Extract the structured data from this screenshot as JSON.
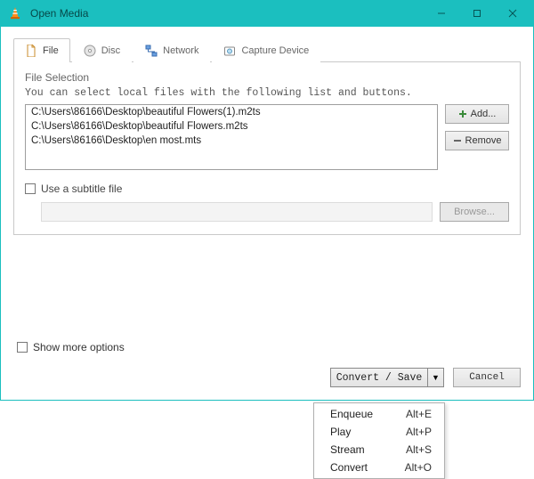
{
  "window": {
    "title": "Open Media"
  },
  "tabs": {
    "file": "File",
    "disc": "Disc",
    "network": "Network",
    "capture": "Capture Device"
  },
  "fileSelection": {
    "heading": "File Selection",
    "hint": "You can select local files with the following list and buttons.",
    "files": [
      "C:\\Users\\86166\\Desktop\\beautiful Flowers(1).m2ts",
      "C:\\Users\\86166\\Desktop\\beautiful Flowers.m2ts",
      "C:\\Users\\86166\\Desktop\\en most.mts"
    ],
    "addLabel": "Add...",
    "removeLabel": "Remove"
  },
  "subtitle": {
    "checkboxLabel": "Use a subtitle file",
    "browseLabel": "Browse..."
  },
  "footer": {
    "showMore": "Show more options",
    "convertSave": "Convert / Save",
    "cancel": "Cancel"
  },
  "menu": [
    {
      "label": "Enqueue",
      "shortcut": "Alt+E"
    },
    {
      "label": "Play",
      "shortcut": "Alt+P"
    },
    {
      "label": "Stream",
      "shortcut": "Alt+S"
    },
    {
      "label": "Convert",
      "shortcut": "Alt+O"
    }
  ]
}
